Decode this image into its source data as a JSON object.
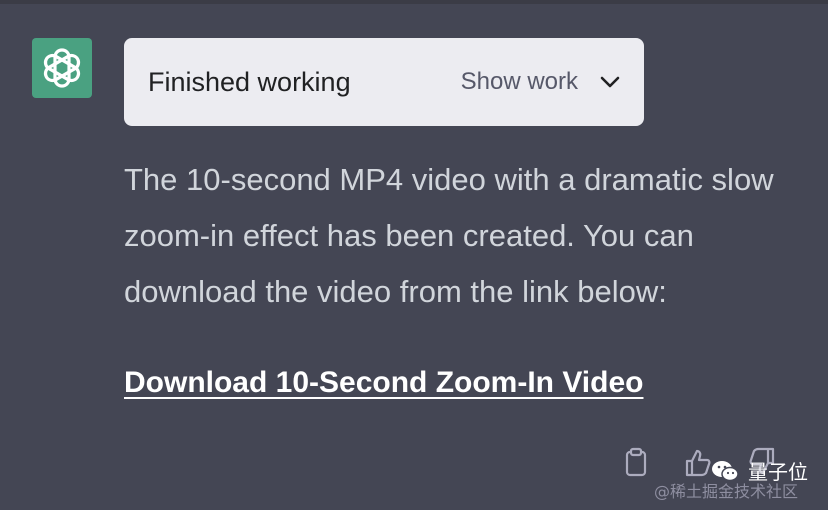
{
  "colors": {
    "background": "#444654",
    "avatar_bg": "#4aa181",
    "work_box_bg": "#ececf1",
    "text": "#d1d5db",
    "link": "#ffffff"
  },
  "assistant": {
    "avatar_icon": "openai-logo-icon"
  },
  "work_status": {
    "title": "Finished working",
    "toggle_label": "Show work",
    "toggle_icon": "chevron-down-icon"
  },
  "message": {
    "lines": [
      "The 10-second MP4 video with a dramatic slow",
      "zoom-in effect has been created. You can",
      "download the video from the link below:"
    ],
    "link_text": "Download 10-Second Zoom-In Video"
  },
  "actions": {
    "icons": [
      "clipboard-icon",
      "thumbs-up-icon",
      "thumbs-down-icon"
    ]
  },
  "watermark": {
    "brand": "量子位",
    "line2": "@稀土掘金技术社区"
  }
}
